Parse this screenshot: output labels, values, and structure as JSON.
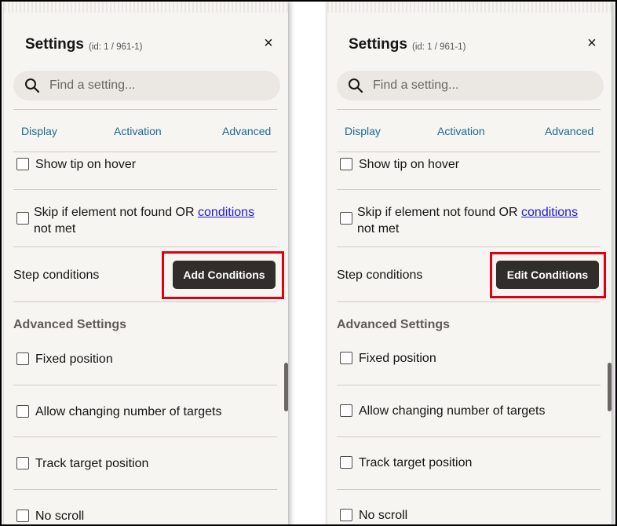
{
  "panels": [
    {
      "title": "Settings",
      "id_text": "(id: 1 / 961-1)",
      "close_glyph": "×",
      "search": {
        "placeholder": "Find a setting..."
      },
      "tabs": [
        "Display",
        "Activation",
        "Advanced"
      ],
      "options": {
        "show_tip": "Show tip on hover",
        "skip_prefix": "Skip if element not found OR",
        "skip_link": "conditions",
        "skip_suffix": "not met"
      },
      "step_conditions": {
        "label": "Step conditions",
        "button": "Add Conditions"
      },
      "advanced": {
        "heading": "Advanced Settings",
        "items": [
          "Fixed position",
          "Allow changing number of targets",
          "Track target position",
          "No scroll"
        ]
      }
    },
    {
      "title": "Settings",
      "id_text": "(id: 1 / 961-1)",
      "close_glyph": "×",
      "search": {
        "placeholder": "Find a setting..."
      },
      "tabs": [
        "Display",
        "Activation",
        "Advanced"
      ],
      "options": {
        "show_tip": "Show tip on hover",
        "skip_prefix": "Skip if element not found OR",
        "skip_link": "conditions",
        "skip_suffix": "not met"
      },
      "step_conditions": {
        "label": "Step conditions",
        "button": "Edit Conditions"
      },
      "advanced": {
        "heading": "Advanced Settings",
        "items": [
          "Fixed position",
          "Allow changing number of targets",
          "Track target position",
          "No scroll"
        ]
      }
    }
  ],
  "colors": {
    "panel_bg": "#f7f5f2",
    "tab_link": "#1a6a8f",
    "inline_link": "#1d1dc9",
    "button_bg": "#312d2a",
    "highlight": "#e0000f"
  },
  "icons": {
    "search": "search-icon",
    "close": "close-icon",
    "checkbox": "checkbox"
  }
}
